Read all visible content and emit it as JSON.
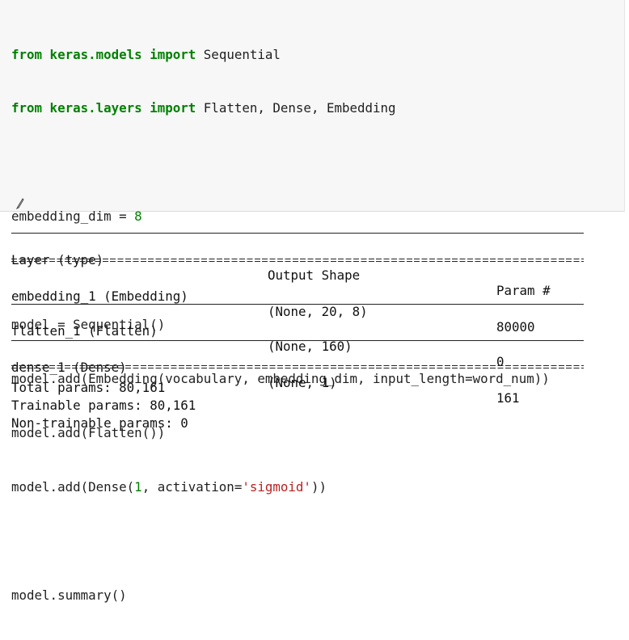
{
  "code_cell": {
    "line1": {
      "kw1": "from",
      "mod": " keras.models ",
      "kw2": "import",
      "rest": " Sequential"
    },
    "line2": {
      "kw1": "from",
      "mod": " keras.layers ",
      "kw2": "import",
      "rest": " Flatten, Dense, Embedding"
    },
    "line4": {
      "a": "embedding_dim = ",
      "num": "8"
    },
    "line6": "model = Sequential()",
    "line7": "model.add(Embedding(vocabulary, embedding_dim, input_length=word_num))",
    "line8": "model.add(Flatten())",
    "line9": {
      "a": "model.add(Dense(",
      "num": "1",
      "b": ", activation=",
      "str": "'sigmoid'",
      "c": "))"
    },
    "line11": "model.summary()"
  },
  "summary": {
    "headers": {
      "layer": "Layer (type)",
      "shape": "Output Shape",
      "params": "Param #"
    },
    "rows": [
      {
        "layer": "embedding_1 (Embedding)",
        "shape": "(None, 20, 8)",
        "params": "80000"
      },
      {
        "layer": "flatten_1 (Flatten)",
        "shape": "(None, 160)",
        "params": "0"
      },
      {
        "layer": "dense_1 (Dense)",
        "shape": "(None, 1)",
        "params": "161"
      }
    ],
    "total": "Total params: 80,161",
    "trainable": "Trainable params: 80,161",
    "non_trainable": "Non-trainable params: 0"
  },
  "colors": {
    "keyword": "#008000",
    "string": "#ba2121",
    "cell_bg": "#f7f7f7"
  },
  "icons": {
    "cursor": "pencil-cursor-icon"
  }
}
